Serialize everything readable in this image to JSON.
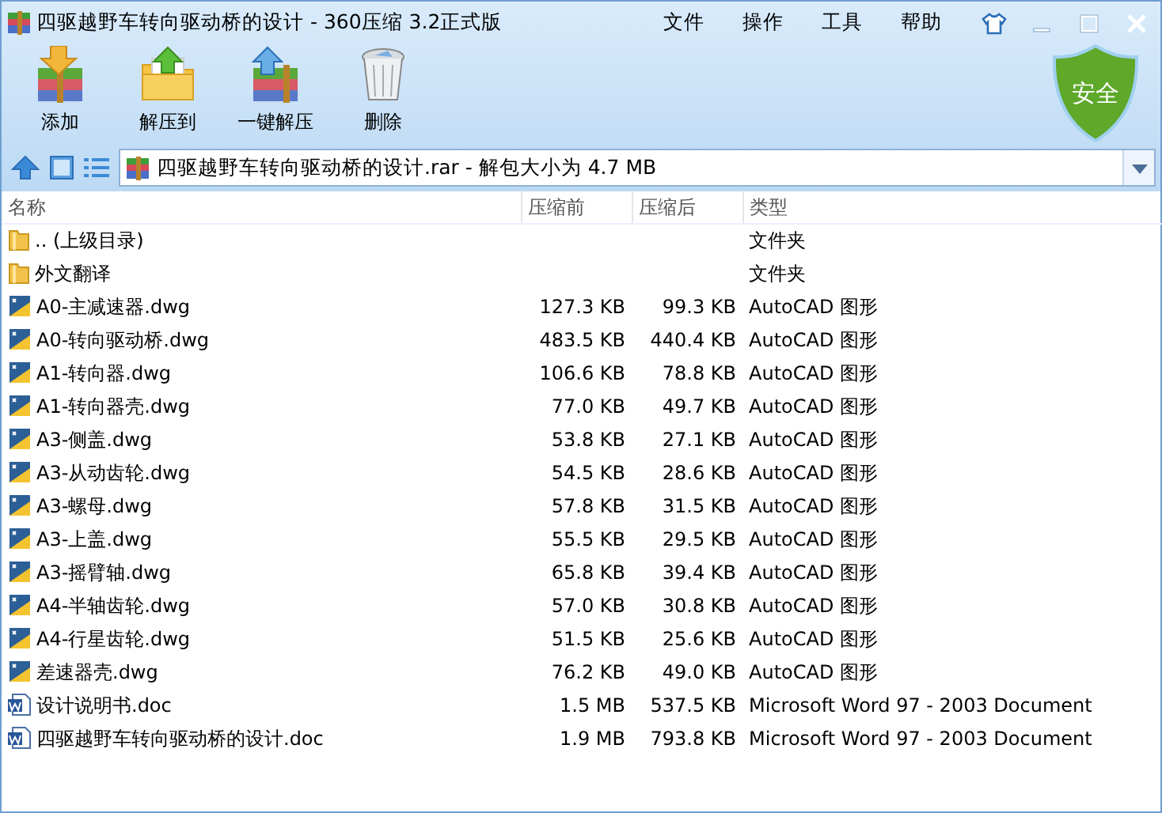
{
  "window": {
    "title": "四驱越野车转向驱动桥的设计 - 360压缩 3.2正式版"
  },
  "menu": [
    "文件",
    "操作",
    "工具",
    "帮助"
  ],
  "toolbar": [
    {
      "label": "添加",
      "kind": "add"
    },
    {
      "label": "解压到",
      "kind": "extract"
    },
    {
      "label": "一键解压",
      "kind": "oneclick"
    },
    {
      "label": "删除",
      "kind": "delete"
    }
  ],
  "badge": "安全",
  "address": {
    "value": "四驱越野车转向驱动桥的设计.rar - 解包大小为 4.7 MB"
  },
  "table": {
    "columns": [
      "名称",
      "压缩前",
      "压缩后",
      "类型"
    ],
    "rows": [
      {
        "kind": "folder",
        "name": ".. (上级目录)",
        "type": "文件夹"
      },
      {
        "kind": "folder",
        "name": "外文翻译",
        "type": "文件夹"
      },
      {
        "kind": "dwg",
        "name": "A0-主减速器.dwg",
        "before": "127.3 KB",
        "after": "99.3 KB",
        "type": "AutoCAD 图形"
      },
      {
        "kind": "dwg",
        "name": "A0-转向驱动桥.dwg",
        "before": "483.5 KB",
        "after": "440.4 KB",
        "type": "AutoCAD 图形"
      },
      {
        "kind": "dwg",
        "name": "A1-转向器.dwg",
        "before": "106.6 KB",
        "after": "78.8 KB",
        "type": "AutoCAD 图形"
      },
      {
        "kind": "dwg",
        "name": "A1-转向器壳.dwg",
        "before": "77.0 KB",
        "after": "49.7 KB",
        "type": "AutoCAD 图形"
      },
      {
        "kind": "dwg",
        "name": "A3-侧盖.dwg",
        "before": "53.8 KB",
        "after": "27.1 KB",
        "type": "AutoCAD 图形"
      },
      {
        "kind": "dwg",
        "name": "A3-从动齿轮.dwg",
        "before": "54.5 KB",
        "after": "28.6 KB",
        "type": "AutoCAD 图形"
      },
      {
        "kind": "dwg",
        "name": "A3-螺母.dwg",
        "before": "57.8 KB",
        "after": "31.5 KB",
        "type": "AutoCAD 图形"
      },
      {
        "kind": "dwg",
        "name": "A3-上盖.dwg",
        "before": "55.5 KB",
        "after": "29.5 KB",
        "type": "AutoCAD 图形"
      },
      {
        "kind": "dwg",
        "name": "A3-摇臂轴.dwg",
        "before": "65.8 KB",
        "after": "39.4 KB",
        "type": "AutoCAD 图形"
      },
      {
        "kind": "dwg",
        "name": "A4-半轴齿轮.dwg",
        "before": "57.0 KB",
        "after": "30.8 KB",
        "type": "AutoCAD 图形"
      },
      {
        "kind": "dwg",
        "name": "A4-行星齿轮.dwg",
        "before": "51.5 KB",
        "after": "25.6 KB",
        "type": "AutoCAD 图形"
      },
      {
        "kind": "dwg",
        "name": "差速器壳.dwg",
        "before": "76.2 KB",
        "after": "49.0 KB",
        "type": "AutoCAD 图形"
      },
      {
        "kind": "doc",
        "name": "设计说明书.doc",
        "before": "1.5 MB",
        "after": "537.5 KB",
        "type": "Microsoft Word 97 - 2003 Document"
      },
      {
        "kind": "doc",
        "name": "四驱越野车转向驱动桥的设计.doc",
        "before": "1.9 MB",
        "after": "793.8 KB",
        "type": "Microsoft Word 97 - 2003 Document"
      }
    ]
  }
}
